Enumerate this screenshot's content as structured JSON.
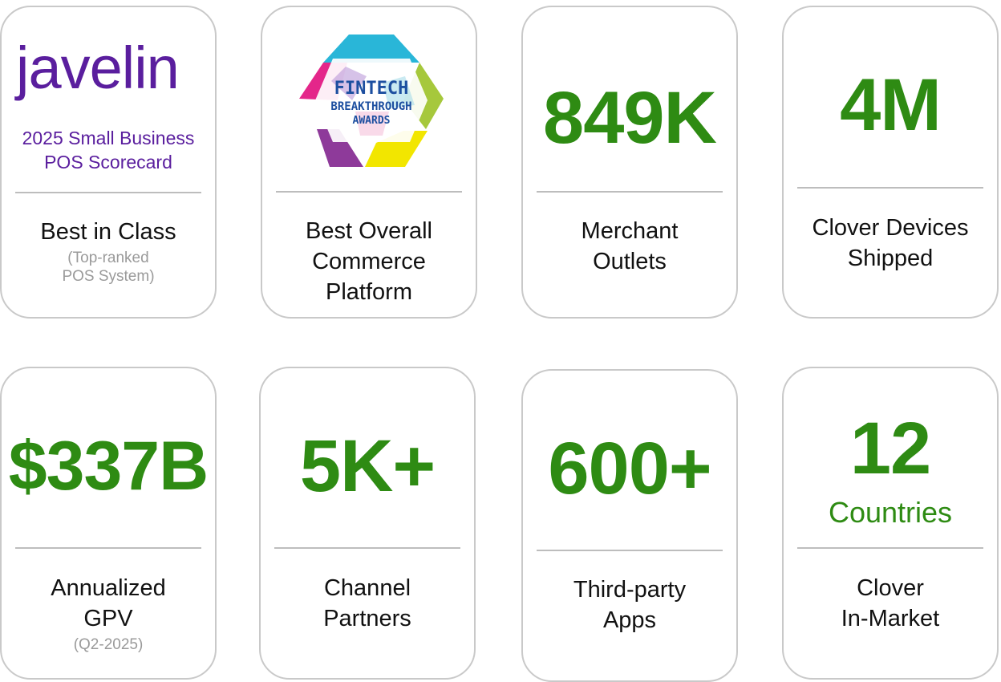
{
  "cards": {
    "javelin": {
      "logo_text": "javelin",
      "subtitle_line1": "2025 Small Business",
      "subtitle_line2": "POS Scorecard",
      "label": "Best in Class",
      "note_line1": "(Top-ranked",
      "note_line2": "POS System)"
    },
    "fintech": {
      "badge_line1": "FINTECH",
      "badge_line2": "BREAKTHROUGH",
      "badge_line3": "AWARDS",
      "label_line1": "Best Overall",
      "label_line2": "Commerce",
      "label_line3": "Platform"
    },
    "merchants": {
      "value": "849K",
      "label_line1": "Merchant",
      "label_line2": "Outlets"
    },
    "devices": {
      "value": "4M",
      "label_line1": "Clover Devices",
      "label_line2": "Shipped"
    },
    "gpv": {
      "value": "$337B",
      "label_line1": "Annualized",
      "label_line2": "GPV",
      "note": "(Q2-2025)"
    },
    "partners": {
      "value": "5K+",
      "label_line1": "Channel",
      "label_line2": "Partners"
    },
    "apps": {
      "value": "600+",
      "label_line1": "Third-party",
      "label_line2": "Apps"
    },
    "countries": {
      "value": "12",
      "unit": "Countries",
      "label_line1": "Clover",
      "label_line2": "In-Market"
    }
  },
  "colors": {
    "stat_green": "#2e8b13",
    "javelin_purple": "#5a1e9e",
    "card_border": "#c9c9c9",
    "badge_text": "#1d4fa0"
  }
}
